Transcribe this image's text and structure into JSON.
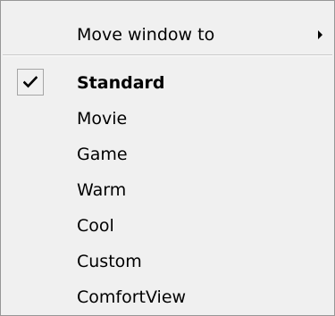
{
  "menu": {
    "move_window": {
      "label": "Move window to",
      "icon": "submenu-arrow-icon"
    },
    "checked_icon": "checkmark-icon",
    "modes": [
      {
        "label": "Standard",
        "checked": true
      },
      {
        "label": "Movie",
        "checked": false
      },
      {
        "label": "Game",
        "checked": false
      },
      {
        "label": "Warm",
        "checked": false
      },
      {
        "label": "Cool",
        "checked": false
      },
      {
        "label": "Custom",
        "checked": false
      },
      {
        "label": "ComfortView",
        "checked": false
      }
    ]
  }
}
